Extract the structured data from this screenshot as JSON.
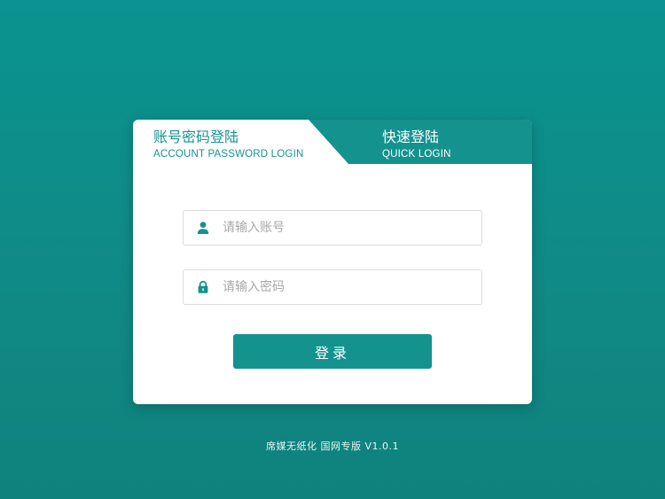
{
  "tabs": {
    "account": {
      "title": "账号密码登陆",
      "subtitle": "ACCOUNT PASSWORD LOGIN",
      "active": true
    },
    "quick": {
      "title": "快速登陆",
      "subtitle": "QUICK LOGIN",
      "active": false
    }
  },
  "form": {
    "account": {
      "icon": "user-icon",
      "value": "",
      "placeholder": "请输入账号"
    },
    "password": {
      "icon": "lock-icon",
      "value": "",
      "placeholder": "请输入密码"
    },
    "login_label": "登录"
  },
  "footer": {
    "version_text": "席媒无纸化 国网专版 V1.0.1"
  },
  "colors": {
    "background": "#0f8c88",
    "accent": "#14928e",
    "card": "#ffffff",
    "input_border": "#dcdcdc",
    "placeholder": "#a8a8a8"
  }
}
